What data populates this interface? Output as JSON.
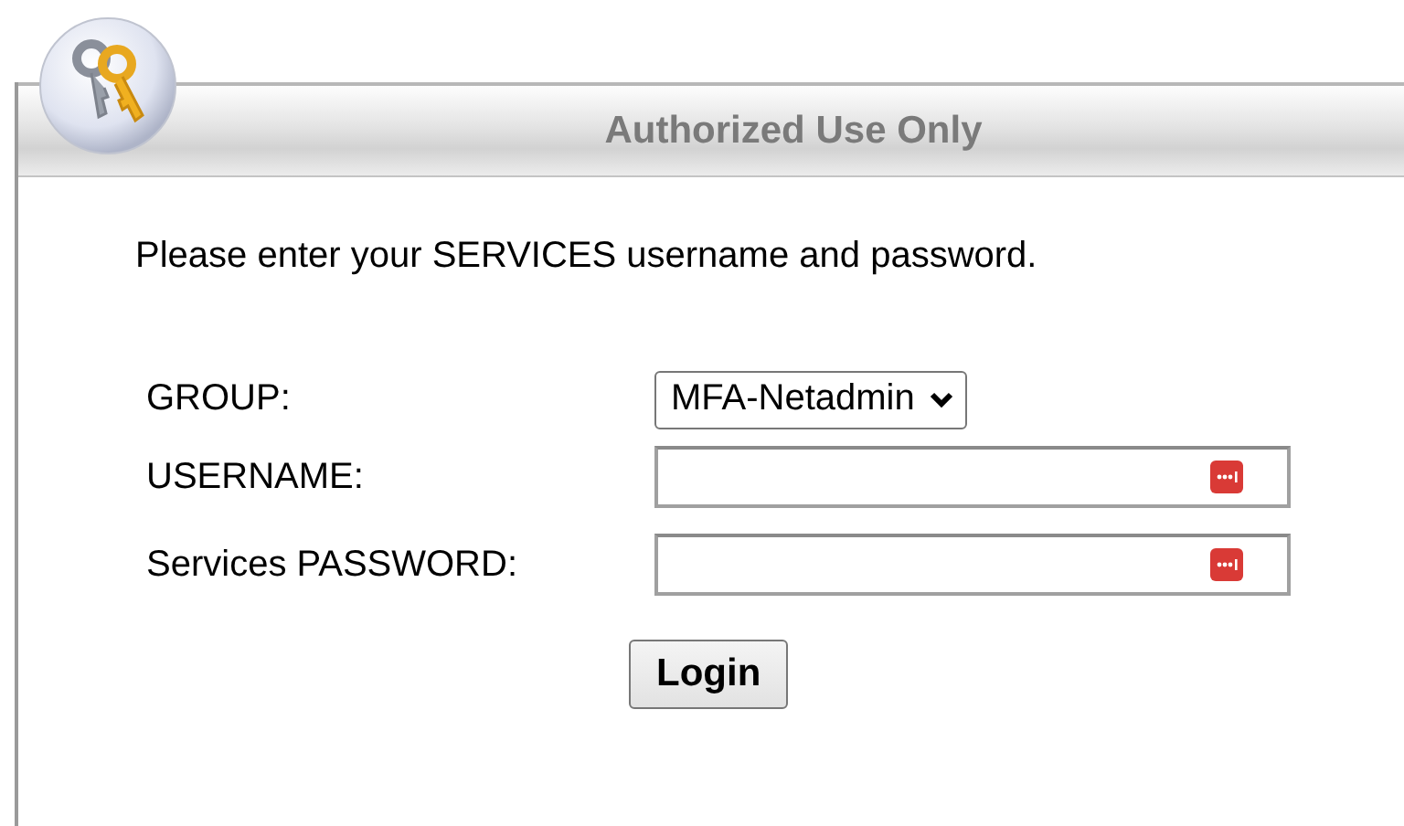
{
  "panel": {
    "title": "Authorized Use Only"
  },
  "prompt": "Please enter your SERVICES username and password.",
  "fields": [
    {
      "label": "GROUP:",
      "kind": "select",
      "value": "MFA-Netadmin"
    },
    {
      "label": "USERNAME:",
      "kind": "text"
    },
    {
      "label": "Services PASSWORD:",
      "kind": "password"
    }
  ],
  "button": "Login"
}
